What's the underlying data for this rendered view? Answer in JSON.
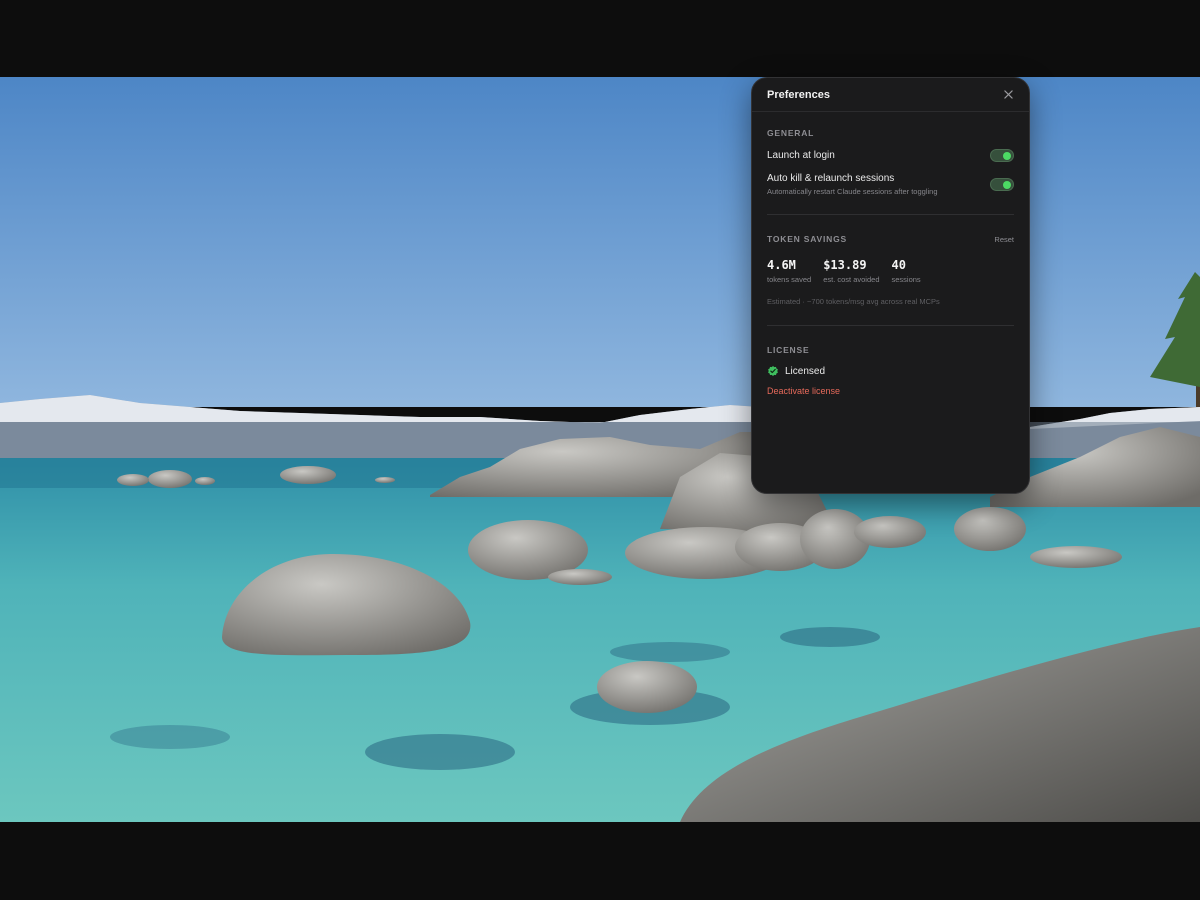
{
  "window": {
    "title": "Preferences",
    "close_icon": "close-icon"
  },
  "general": {
    "title": "GENERAL",
    "launch_at_login": {
      "label": "Launch at login",
      "enabled": true
    },
    "auto_kill": {
      "label": "Auto kill & relaunch sessions",
      "description": "Automatically restart Claude sessions after toggling",
      "enabled": true
    }
  },
  "token_savings": {
    "title": "TOKEN SAVINGS",
    "reset_label": "Reset",
    "stats": [
      {
        "value": "4.6M",
        "label": "tokens saved"
      },
      {
        "value": "$13.89",
        "label": "est. cost avoided"
      },
      {
        "value": "40",
        "label": "sessions"
      }
    ],
    "note": "Estimated · ~700 tokens/msg avg across real MCPs"
  },
  "license": {
    "title": "LICENSE",
    "status": "Licensed",
    "status_icon": "verified-badge-icon",
    "deactivate_label": "Deactivate license"
  },
  "colors": {
    "accent_green": "#4cd964",
    "danger": "#e5695a",
    "panel_bg": "#1b1b1c"
  }
}
